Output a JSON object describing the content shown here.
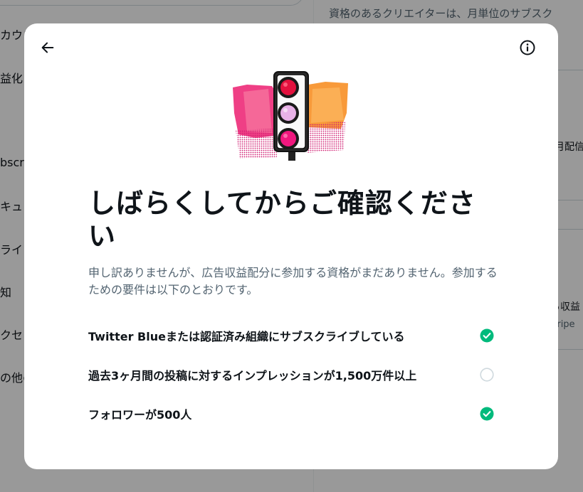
{
  "background": {
    "left_items": [
      "カウン",
      "益化",
      "bscri",
      "キュ",
      "ライ",
      "知",
      "クセ",
      "の他の"
    ],
    "right_text": "資格のあるクリエイターは、月単位のサブスク",
    "card_texts": [
      "月配信",
      "ら収益",
      "Stripe"
    ]
  },
  "modal": {
    "back_icon": "arrow-left-icon",
    "info_icon": "info-circle-icon",
    "illustration_icon": "traffic-light-illustration",
    "title": "しばらくしてからご確認ください",
    "subtitle": "申し訳ありませんが、広告収益配分に参加する資格がまだありません。参加するための要件は以下のとおりです。",
    "requirements": [
      {
        "label": "Twitter Blueまたは認証済み組織にサブスクライブしている",
        "met": true
      },
      {
        "label": "過去3ヶ月間の投稿に対するインプレッションが1,500万件以上",
        "met": false
      },
      {
        "label": "フォロワーが500人",
        "met": true
      }
    ]
  },
  "colors": {
    "check_met": "#00ba7c",
    "check_unmet_border": "#cfd9de",
    "title_text": "#0f1419",
    "secondary_text": "#536471",
    "overlay": "rgba(0,0,0,0.4)"
  }
}
